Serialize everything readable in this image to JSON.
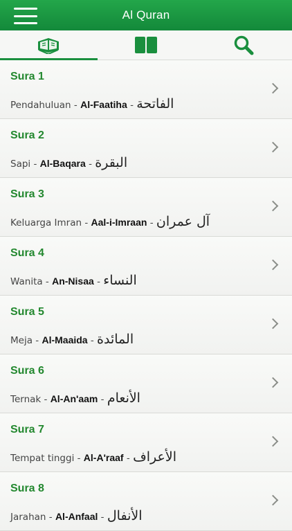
{
  "header": {
    "title": "Al Quran"
  },
  "tabs": [
    {
      "icon": "quran-book-icon"
    },
    {
      "icon": "open-book-icon"
    },
    {
      "icon": "search-icon"
    }
  ],
  "colors": {
    "accent": "#1a8f3e",
    "header": "#1e9c44",
    "sura_label": "#23882f"
  },
  "suras": [
    {
      "label": "Sura 1",
      "name": "Pendahuluan",
      "translit": "Al-Faatiha",
      "arabic": "الفاتحة"
    },
    {
      "label": "Sura 2",
      "name": "Sapi",
      "translit": "Al-Baqara",
      "arabic": "البقرة"
    },
    {
      "label": "Sura 3",
      "name": "Keluarga Imran",
      "translit": "Aal-i-Imraan",
      "arabic": "آل عمران"
    },
    {
      "label": "Sura 4",
      "name": "Wanita",
      "translit": "An-Nisaa",
      "arabic": "النساء"
    },
    {
      "label": "Sura 5",
      "name": "Meja",
      "translit": "Al-Maaida",
      "arabic": "المائدة"
    },
    {
      "label": "Sura 6",
      "name": "Ternak",
      "translit": "Al-An'aam",
      "arabic": "الأنعام"
    },
    {
      "label": "Sura 7",
      "name": "Tempat tinggi",
      "translit": "Al-A'raaf",
      "arabic": "الأعراف"
    },
    {
      "label": "Sura 8",
      "name": "Jarahan",
      "translit": "Al-Anfaal",
      "arabic": "الأنفال"
    }
  ]
}
